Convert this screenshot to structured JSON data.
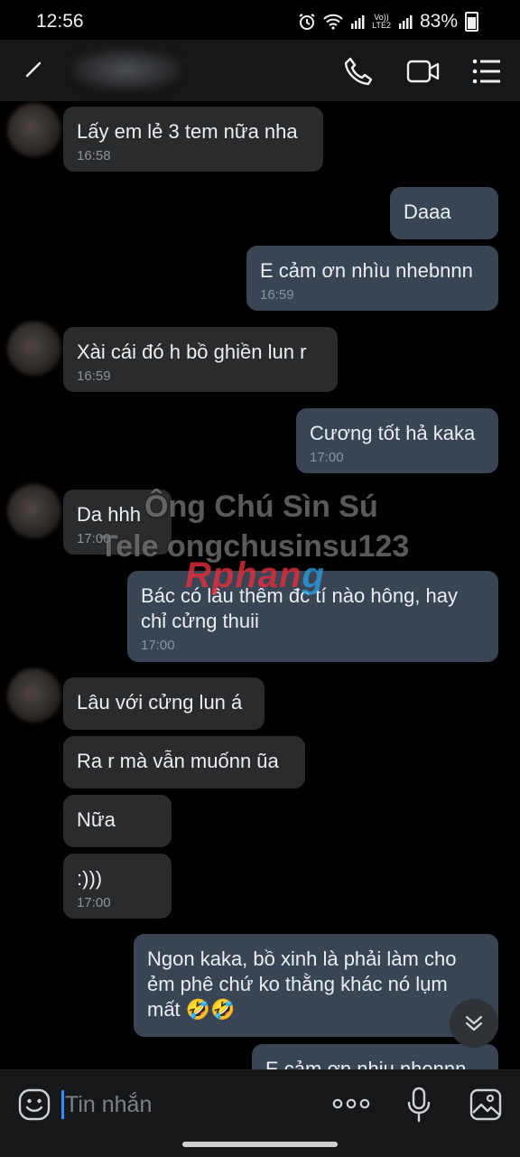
{
  "status_bar": {
    "time": "12:56",
    "battery": "83%",
    "network_label_top": "Vo))",
    "network_label_bottom": "LTE2"
  },
  "header": {
    "icons": [
      "back-icon",
      "phone-icon",
      "video-call-icon",
      "menu-icon"
    ]
  },
  "messages": [
    {
      "side": "in",
      "text": "Lấy em lẻ 3 tem nữa nha",
      "time": "16:58"
    },
    {
      "side": "out",
      "text": "Daaa",
      "time": ""
    },
    {
      "side": "out",
      "text": "E cảm ơn nhìu nhebnnn",
      "time": "16:59"
    },
    {
      "side": "in",
      "text": "Xài cái đó h bồ ghiền lun r",
      "time": "16:59"
    },
    {
      "side": "out",
      "text": "Cương tốt hả kaka",
      "time": "17:00"
    },
    {
      "side": "in",
      "text": "Da hhh",
      "time": "17:00"
    },
    {
      "side": "out",
      "text": "Bác có lâu thêm đc tí nào hông, hay chỉ cửng thuii",
      "time": "17:00"
    },
    {
      "side": "in",
      "text": "Lâu với cửng lun á",
      "time": ""
    },
    {
      "side": "in",
      "text": "Ra r mà vẫn muốnn ũa",
      "time": ""
    },
    {
      "side": "in",
      "text": "Nữa",
      "time": ""
    },
    {
      "side": "in",
      "text": ":)))",
      "time": "17:00"
    },
    {
      "side": "out",
      "text": "Ngon kaka, bồ xinh là phải làm cho ẻm phê chứ ko thằng khác nó lụm mất 🤣🤣",
      "time": ""
    },
    {
      "side": "out",
      "text": "E cảm ơn nhiu nhennn",
      "time": ""
    }
  ],
  "watermark": {
    "line1": "Ông Chú Sìn Sú",
    "line2": "Tele ongchusinsu123",
    "logo_main": "Rphan",
    "logo_tail": "g"
  },
  "composer": {
    "placeholder": "Tin nhắn",
    "icons": [
      "emoji-icon",
      "more-options-icon",
      "microphone-icon",
      "image-icon"
    ]
  },
  "colors": {
    "incoming_bubble": "#2a2b2d",
    "outgoing_bubble": "#394555",
    "background": "#000000",
    "caret": "#2f8bff"
  }
}
